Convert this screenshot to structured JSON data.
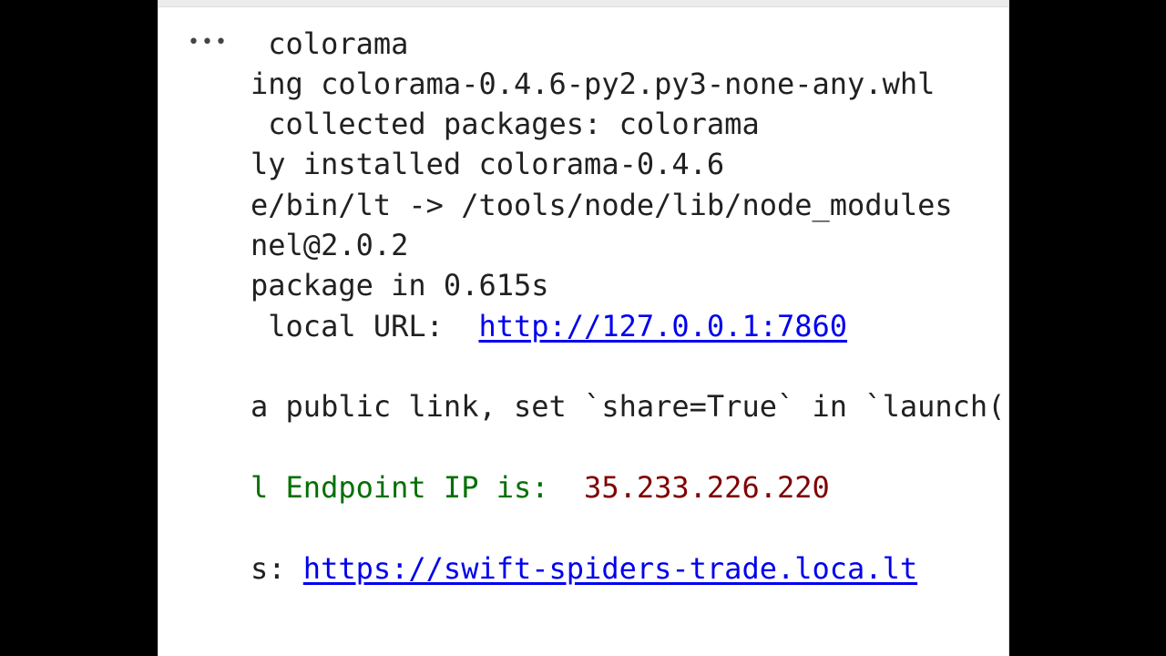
{
  "cell_output": {
    "menu_icon": "•••",
    "lines": [
      {
        "text": " colorama"
      },
      {
        "text": "ing colorama-0.4.6-py2.py3-none-any.whl"
      },
      {
        "text": " collected packages: colorama"
      },
      {
        "text": "ly installed colorama-0.4.6"
      },
      {
        "text": "e/bin/lt -> /tools/node/lib/node_modules"
      },
      {
        "text": "nel@2.0.2"
      },
      {
        "text": "package in 0.615s"
      },
      {
        "prefix": " local URL:  ",
        "link": "http://127.0.0.1:7860"
      },
      {
        "text": "a public link, set `share=True` in `launch()`."
      },
      {
        "prefix": "l Endpoint IP is:  ",
        "value": "35.233.226.220"
      },
      {
        "prefix": "s: ",
        "link": "https://swift-spiders-trade.loca.lt"
      }
    ]
  },
  "colors": {
    "background": "#000000",
    "panel": "#ffffff",
    "text": "#212121",
    "link": "#0000ee",
    "label_green": "#007000",
    "value_red": "#800000"
  }
}
